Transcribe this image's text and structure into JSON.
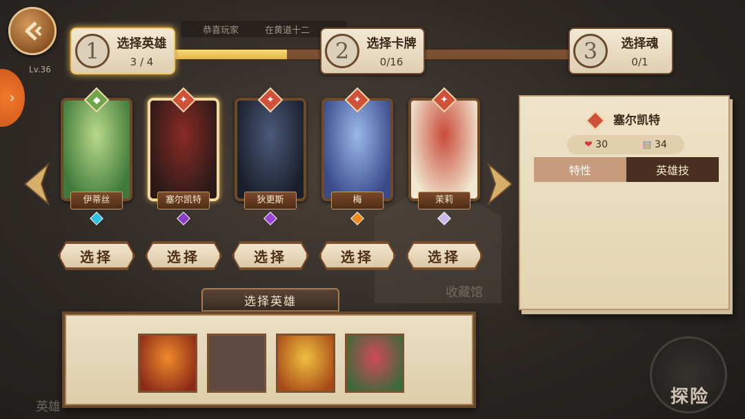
{
  "top": {
    "level": "Lv.36",
    "ticker": [
      "恭喜玩家",
      "在黄道十二"
    ]
  },
  "steps": [
    {
      "num": "1",
      "title": "选择英雄",
      "count": "3 / 4"
    },
    {
      "num": "2",
      "title": "选择卡牌",
      "count": "0/16"
    },
    {
      "num": "3",
      "title": "选择魂",
      "count": "0/1"
    }
  ],
  "progress_fraction": 0.3,
  "heroes": [
    {
      "name": "伊蒂丝",
      "badge": "◆",
      "badge_color": "#6fa54a",
      "gem_color": "#2ec1e8",
      "art_colors": [
        "#b9d98a",
        "#3f7a3a"
      ]
    },
    {
      "name": "塞尔凯特",
      "badge": "✦",
      "badge_color": "#d0513a",
      "gem_color": "#8a3cc8",
      "art_colors": [
        "#8a2a24",
        "#2a1a18"
      ]
    },
    {
      "name": "狄更斯",
      "badge": "✦",
      "badge_color": "#d0513a",
      "gem_color": "#9a44d8",
      "art_colors": [
        "#4a5a7a",
        "#1a1e2a"
      ]
    },
    {
      "name": "梅",
      "badge": "✦",
      "badge_color": "#d0513a",
      "gem_color": "#f08a1a",
      "art_colors": [
        "#9ab8e8",
        "#3a4a8a"
      ]
    },
    {
      "name": "茉莉",
      "badge": "✦",
      "badge_color": "#d0513a",
      "gem_color": "#c8b8e8",
      "art_colors": [
        "#c94a3a",
        "#f0e8d0"
      ]
    }
  ],
  "select_label": "选择",
  "info_panel": {
    "hero_name": "塞尔凯特",
    "hp": "30",
    "card_count": "34",
    "tabs": [
      "特性",
      "英雄技"
    ]
  },
  "section_label": "选择英雄",
  "selected_slots": [
    {
      "filled": true,
      "art_colors": [
        "#f08a2a",
        "#8a2a18"
      ]
    },
    {
      "filled": false
    },
    {
      "filled": true,
      "art_colors": [
        "#f0c040",
        "#a84a18"
      ]
    },
    {
      "filled": true,
      "art_colors": [
        "#d04a5a",
        "#3a6a3a"
      ]
    }
  ],
  "background": {
    "museum": "收藏馆",
    "explore": "探险",
    "heroes_tab": "英雄"
  }
}
